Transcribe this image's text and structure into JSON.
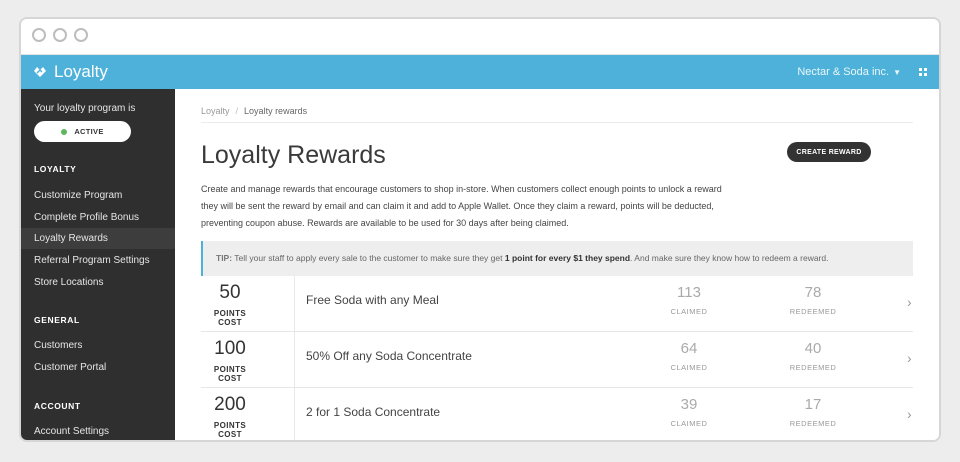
{
  "app": {
    "name": "Loyalty",
    "company": "Nectar & Soda inc."
  },
  "sidebar": {
    "program_text": "Your loyalty program is",
    "status": "ACTIVE",
    "sections": [
      {
        "title": "LOYALTY",
        "items": [
          "Customize Program",
          "Complete Profile Bonus",
          "Loyalty Rewards",
          "Referral Program Settings",
          "Store Locations"
        ]
      },
      {
        "title": "GENERAL",
        "items": [
          "Customers",
          "Customer Portal"
        ]
      },
      {
        "title": "ACCOUNT",
        "items": [
          "Account Settings"
        ]
      }
    ]
  },
  "breadcrumb": {
    "root": "Loyalty",
    "separator": "/",
    "current": "Loyalty rewards"
  },
  "page": {
    "title": "Loyalty Rewards",
    "create_button": "CREATE REWARD",
    "description": "Create and manage rewards that encourage customers to shop in-store. When customers collect enough points to unlock a reward they will be sent the reward by email and can claim it and add to Apple Wallet. Once they claim a reward, points will be deducted, preventing coupon abuse. Rewards are available to be used for 30 days after being claimed."
  },
  "tip": {
    "label": "TIP:",
    "text_1": "Tell your staff to apply every sale to the customer to make sure they get",
    "bold": "1 point for every $1 they spend",
    "text_2": ". And make sure they know how to redeem a reward."
  },
  "rewards": [
    {
      "points": "50",
      "points_label": "POINTS COST",
      "name": "Free Soda with any Meal",
      "claimed": "113",
      "claimed_label": "CLAIMED",
      "redeemed": "78",
      "redeemed_label": "REDEEMED"
    },
    {
      "points": "100",
      "points_label": "POINTS COST",
      "name": "50% Off any Soda Concentrate",
      "claimed": "64",
      "claimed_label": "CLAIMED",
      "redeemed": "40",
      "redeemed_label": "REDEEMED"
    },
    {
      "points": "200",
      "points_label": "POINTS COST",
      "name": "2 for 1 Soda Concentrate",
      "claimed": "39",
      "claimed_label": "CLAIMED",
      "redeemed": "17",
      "redeemed_label": "REDEEMED"
    }
  ],
  "colors": {
    "accent": "#4db1d9",
    "sidebar": "#2f2f2f",
    "active_dot": "#5cb85c"
  }
}
